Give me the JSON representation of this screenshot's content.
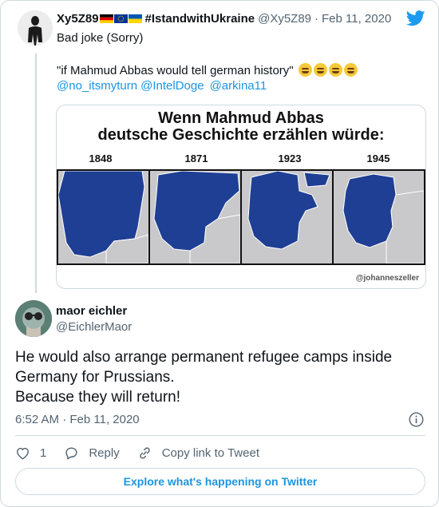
{
  "parent": {
    "author_name": "Xy5Z89",
    "hashtag": "#IstandwithUkraine",
    "handle": "@Xy5Z89",
    "separator": "·",
    "date": "Feb 11, 2020",
    "line1": "Bad joke (Sorry)",
    "line2": "\"if Mahmud Abbas would tell german history\"",
    "mentions": [
      "@no_itsmyturn",
      "@IntelDoge",
      "@arkina11"
    ],
    "media": {
      "title_line1": "Wenn Mahmud Abbas",
      "title_line2": "deutsche Geschichte erzählen würde:",
      "years": [
        "1848",
        "1871",
        "1923",
        "1945"
      ],
      "credit": "@johanneszeller"
    }
  },
  "tweet": {
    "author_name": "maor eichler",
    "handle": "@EichlerMaor",
    "body_lines": [
      "He would also arrange permanent refugee camps inside",
      "Germany for Prussians.",
      "Because they will return!"
    ],
    "timestamp": "6:52 AM · Feb 11, 2020"
  },
  "actions": {
    "like_count": "1",
    "reply_label": "Reply",
    "copy_link_label": "Copy link to Tweet"
  },
  "explore_label": "Explore what's happening on Twitter",
  "colors": {
    "twitter_blue": "#1d9bf0",
    "link_blue": "#1b95e0",
    "map_blue": "#1f3f94",
    "muted": "#536471"
  },
  "icons": [
    "twitter-bird-icon",
    "flag-germany-icon",
    "flag-eu-icon",
    "flag-ukraine-icon",
    "grinning-sweat-emoji-icon",
    "tears-of-joy-emoji-icon",
    "info-icon",
    "heart-icon",
    "reply-bubble-icon",
    "link-icon"
  ]
}
